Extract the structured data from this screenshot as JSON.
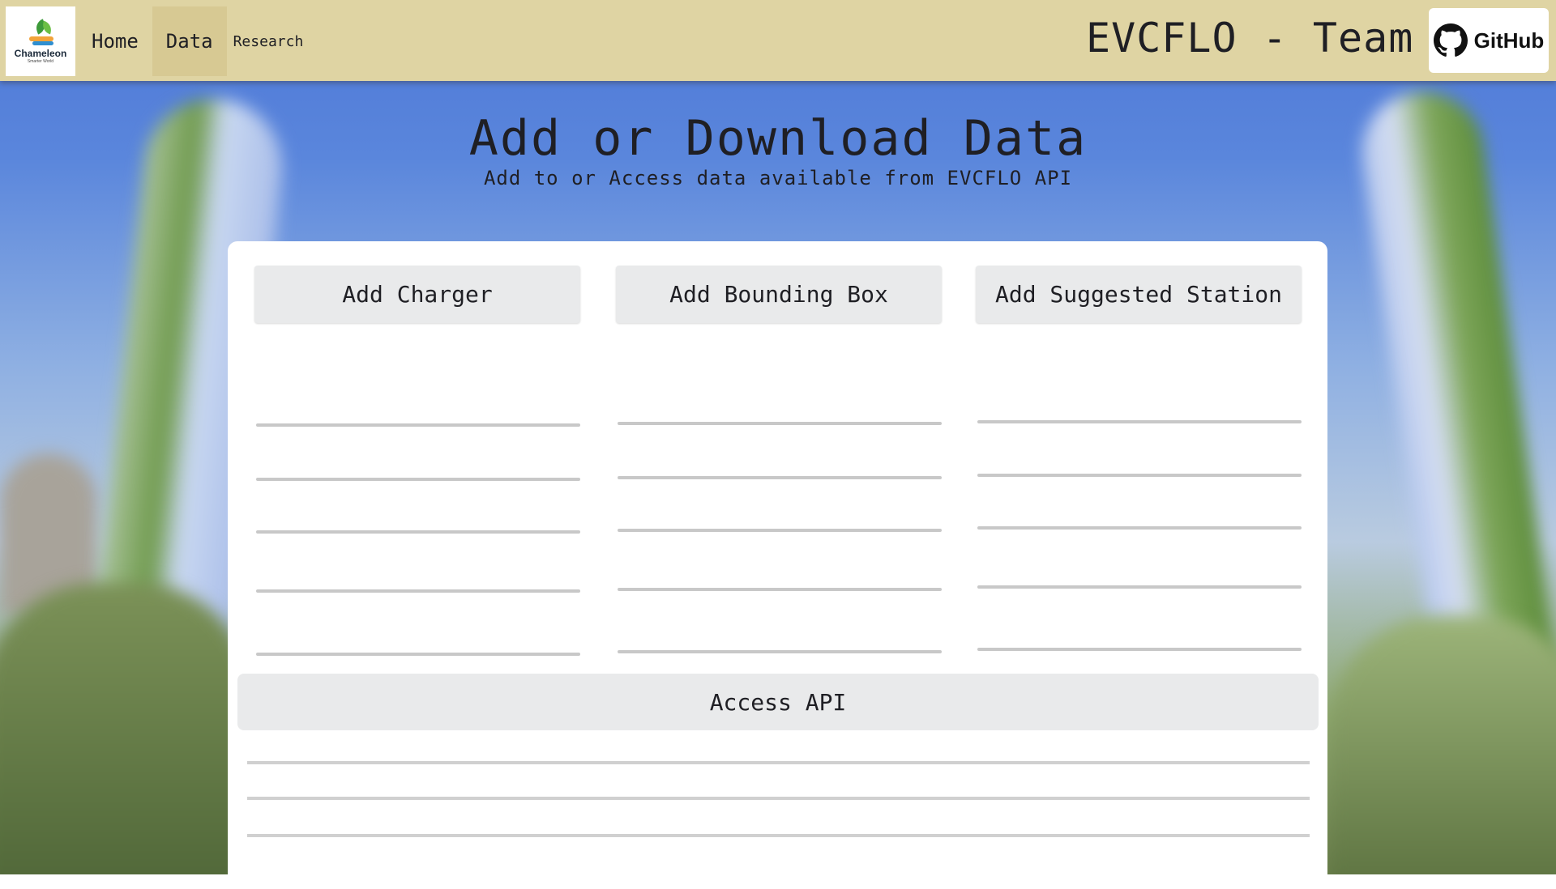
{
  "header": {
    "logo": {
      "name": "Chameleon",
      "tagline": "Smarter World"
    },
    "nav": [
      {
        "label": "Home",
        "active": false
      },
      {
        "label": "Data",
        "active": true
      },
      {
        "label": "Research",
        "active": false
      }
    ],
    "team_title": "EVCFLO - Team",
    "github_label": "GitHub"
  },
  "main": {
    "title": "Add or Download Data",
    "subtitle": "Add to or Access data available from EVCFLO API"
  },
  "card": {
    "columns": [
      {
        "button_label": "Add Charger",
        "field_count": 6
      },
      {
        "button_label": "Add Bounding Box",
        "field_count": 6
      },
      {
        "button_label": "Add Suggested Station",
        "field_count": 6
      }
    ],
    "api": {
      "button_label": "Access API",
      "field_count": 3
    }
  },
  "colors": {
    "header_bg": "#dfd4a3",
    "nav_active_bg": "#d7c993",
    "button_bg": "#e9eaeb",
    "card_bg": "#ffffff"
  }
}
